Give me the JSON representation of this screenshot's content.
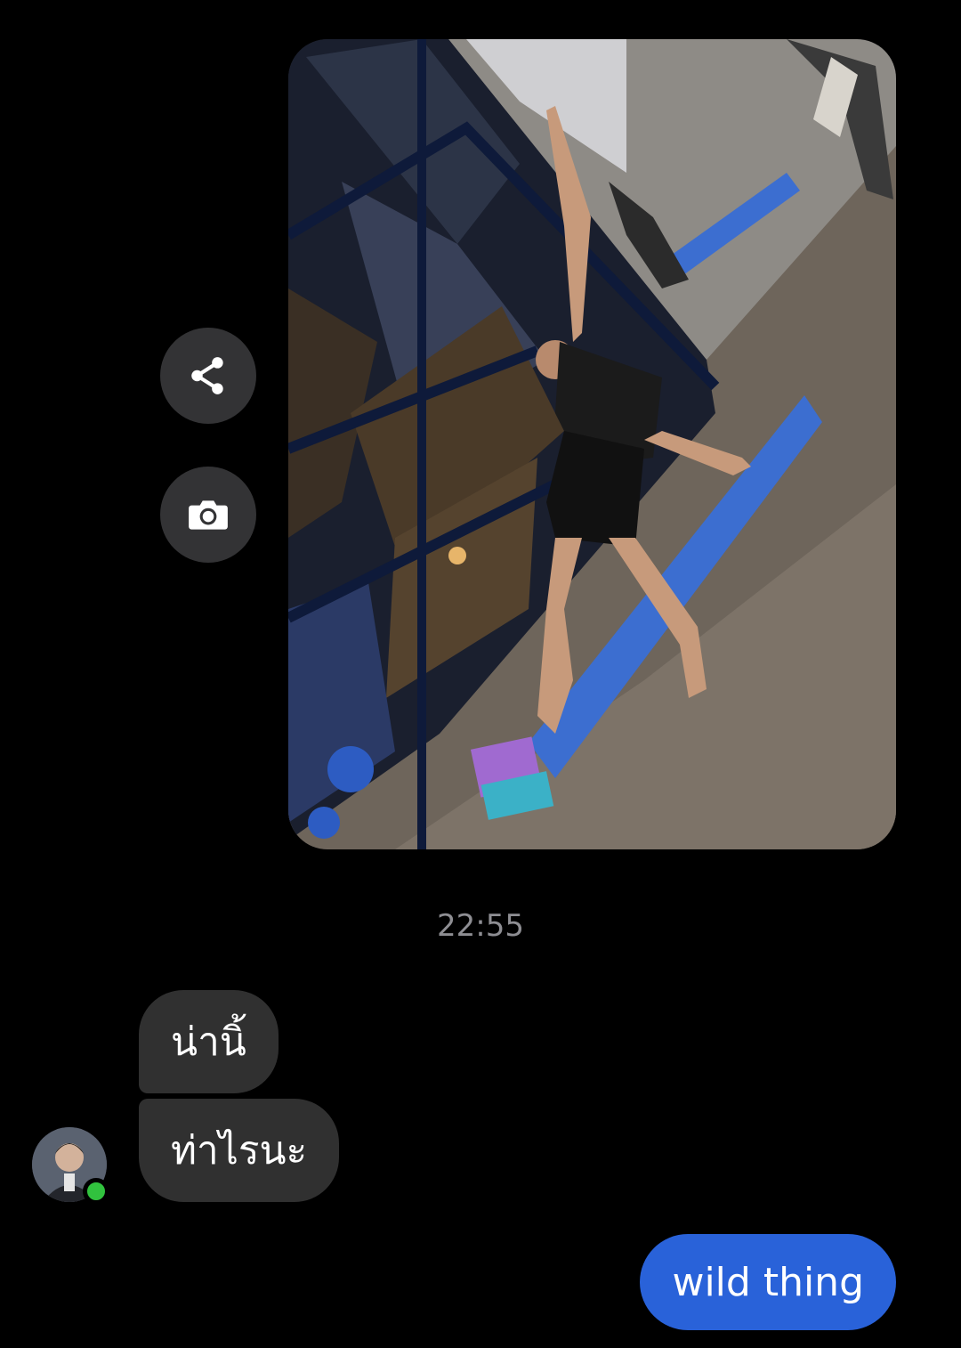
{
  "conversation": {
    "photo": {
      "description_icon": "photo-of-person-doing-yoga"
    },
    "actions": {
      "share_icon": "share-icon",
      "camera_icon": "camera-icon"
    },
    "timestamp": "22:55",
    "incoming": [
      {
        "text": "น่านิ้"
      },
      {
        "text": "ท่าไรนะ"
      }
    ],
    "outgoing": [
      {
        "text": "wild thing"
      }
    ],
    "colors": {
      "background": "#000000",
      "incoming_bubble": "#303030",
      "outgoing_bubble": "#2962d9",
      "online_dot": "#31c23e"
    }
  }
}
